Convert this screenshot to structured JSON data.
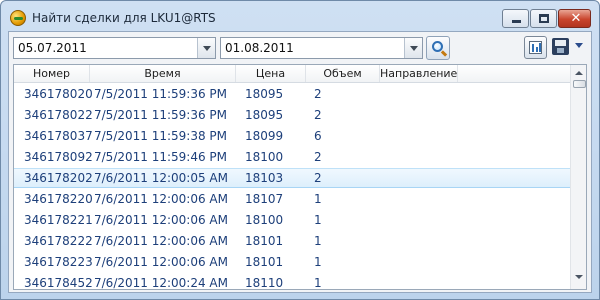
{
  "window": {
    "title": "Найти сделки для LKU1@RTS",
    "close_glyph": "✕"
  },
  "filters": {
    "date_from": "05.07.2011",
    "date_to": "01.08.2011"
  },
  "toolbar": {
    "search_icon": "magnifier-icon",
    "settings_icon": "columns-settings-icon",
    "save_icon": "floppy-disk-icon",
    "menu_icon": "chevron-down-icon",
    "accent": "#2f6fb4"
  },
  "grid": {
    "columns": [
      "Номер",
      "Время",
      "Цена",
      "Объем",
      "Направление"
    ],
    "selected_row_index": 4,
    "rows": [
      {
        "num": "346178020",
        "time": "7/5/2011 11:59:36 PM",
        "price": "18095",
        "vol": "2",
        "dir": ""
      },
      {
        "num": "346178022",
        "time": "7/5/2011 11:59:36 PM",
        "price": "18095",
        "vol": "2",
        "dir": ""
      },
      {
        "num": "346178037",
        "time": "7/5/2011 11:59:38 PM",
        "price": "18099",
        "vol": "6",
        "dir": ""
      },
      {
        "num": "346178092",
        "time": "7/5/2011 11:59:46 PM",
        "price": "18100",
        "vol": "2",
        "dir": ""
      },
      {
        "num": "346178202",
        "time": "7/6/2011 12:00:05 AM",
        "price": "18103",
        "vol": "2",
        "dir": ""
      },
      {
        "num": "346178220",
        "time": "7/6/2011 12:00:06 AM",
        "price": "18107",
        "vol": "1",
        "dir": ""
      },
      {
        "num": "346178221",
        "time": "7/6/2011 12:00:06 AM",
        "price": "18100",
        "vol": "1",
        "dir": ""
      },
      {
        "num": "346178222",
        "time": "7/6/2011 12:00:06 AM",
        "price": "18101",
        "vol": "1",
        "dir": ""
      },
      {
        "num": "346178223",
        "time": "7/6/2011 12:00:06 AM",
        "price": "18101",
        "vol": "1",
        "dir": ""
      },
      {
        "num": "346178452",
        "time": "7/6/2011 12:00:24 AM",
        "price": "18110",
        "vol": "1",
        "dir": ""
      }
    ]
  }
}
